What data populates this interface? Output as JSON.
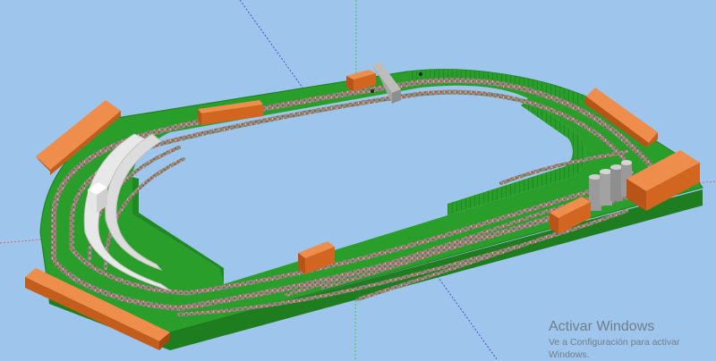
{
  "viewport": {
    "background": "#9ec6ec",
    "axis_colors": {
      "blue": "#4b4bd0",
      "red": "#cf6767",
      "green": "#3fc83f"
    }
  },
  "layout_model": {
    "board_color": "#2a9e2a",
    "board_edge_color": "#1e7d1e",
    "ballast_color": "#8f8a7c",
    "platform_color": "#e8e8e8",
    "building_color": "#d2651f",
    "building_top_color": "#ee8d4c",
    "silo_color": "#9a9a9a"
  },
  "watermark": {
    "title": "Activar Windows",
    "subtitle": "Ve a Configuración para activar Windows."
  }
}
